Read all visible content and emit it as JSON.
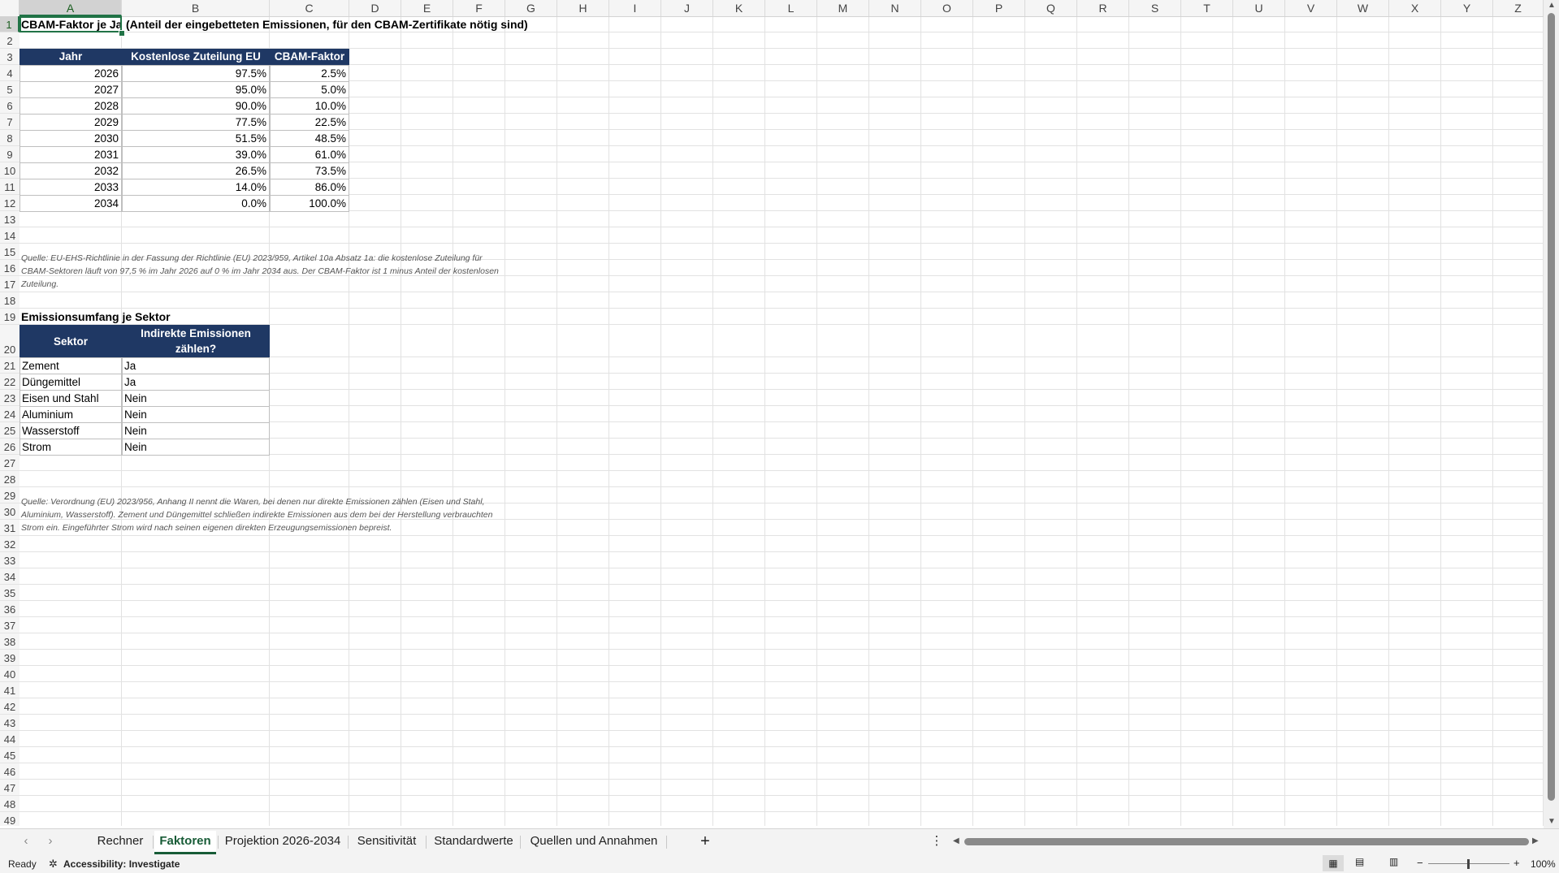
{
  "columns": [
    "A",
    "B",
    "C",
    "D",
    "E",
    "F",
    "G",
    "H",
    "I",
    "J",
    "K",
    "L",
    "M",
    "N",
    "O",
    "P",
    "Q",
    "R",
    "S",
    "T",
    "U",
    "V",
    "W",
    "X",
    "Y",
    "Z"
  ],
  "rows": [
    "1",
    "2",
    "3",
    "4",
    "5",
    "6",
    "7",
    "8",
    "9",
    "10",
    "11",
    "12",
    "13",
    "14",
    "15",
    "16",
    "17",
    "18",
    "19",
    "20",
    "21",
    "22",
    "23",
    "24",
    "25",
    "26",
    "27",
    "28",
    "29",
    "30",
    "31",
    "32",
    "33",
    "34",
    "35",
    "36",
    "37",
    "38",
    "39",
    "40",
    "41",
    "42",
    "43",
    "44",
    "45",
    "46",
    "47",
    "48",
    "49"
  ],
  "title_a1": "CBAM-Faktor je Jahr",
  "title_rest": "(Anteil der eingebetteten Emissionen, für den CBAM-Zertifikate nötig sind)",
  "factor_table": {
    "headers": [
      "Jahr",
      "Kostenlose Zuteilung EU",
      "CBAM-Faktor"
    ],
    "rows": [
      [
        "2026",
        "97.5%",
        "2.5%"
      ],
      [
        "2027",
        "95.0%",
        "5.0%"
      ],
      [
        "2028",
        "90.0%",
        "10.0%"
      ],
      [
        "2029",
        "77.5%",
        "22.5%"
      ],
      [
        "2030",
        "51.5%",
        "48.5%"
      ],
      [
        "2031",
        "39.0%",
        "61.0%"
      ],
      [
        "2032",
        "26.5%",
        "73.5%"
      ],
      [
        "2033",
        "14.0%",
        "86.0%"
      ],
      [
        "2034",
        "0.0%",
        "100.0%"
      ]
    ]
  },
  "note1": "Quelle: EU-EHS-Richtlinie in der Fassung der Richtlinie (EU) 2023/959, Artikel 10a Absatz 1a: die kostenlose Zuteilung für CBAM-Sektoren läuft von 97,5 % im Jahr 2026 auf 0 % im Jahr 2034 aus. Der CBAM-Faktor ist 1 minus Anteil der kostenlosen Zuteilung.",
  "section2_title": "Emissionsumfang je Sektor",
  "sector_table": {
    "headers": [
      "Sektor",
      "Indirekte Emissionen zählen?"
    ],
    "rows": [
      [
        "Zement",
        "Ja"
      ],
      [
        "Düngemittel",
        "Ja"
      ],
      [
        "Eisen und Stahl",
        "Nein"
      ],
      [
        "Aluminium",
        "Nein"
      ],
      [
        "Wasserstoff",
        "Nein"
      ],
      [
        "Strom",
        "Nein"
      ]
    ]
  },
  "note2": "Quelle: Verordnung (EU) 2023/956, Anhang II nennt die Waren, bei denen nur direkte Emissionen zählen (Eisen und Stahl, Aluminium, Wasserstoff). Zement und Düngemittel schließen indirekte Emissionen aus dem bei der Herstellung verbrauchten Strom ein. Eingeführter Strom wird nach seinen eigenen direkten Erzeugungsemissionen bepreist.",
  "tabs": [
    "Rechner",
    "Faktoren",
    "Projektion 2026-2034",
    "Sensitivität",
    "Standardwerte",
    "Quellen und Annahmen"
  ],
  "active_tab": "Faktoren",
  "add_sheet": "+",
  "status": {
    "ready": "Ready",
    "accessibility": "Accessibility: Investigate",
    "zoom": "100%",
    "zoom_minus": "−",
    "zoom_plus": "+"
  },
  "icons": [
    "tab-prev-icon",
    "tab-next-icon",
    "more-options-icon",
    "accessibility-icon",
    "normal-view-icon",
    "page-layout-icon",
    "page-break-icon"
  ],
  "colors": {
    "header_fill": "#1f3864",
    "accent": "#217346"
  }
}
